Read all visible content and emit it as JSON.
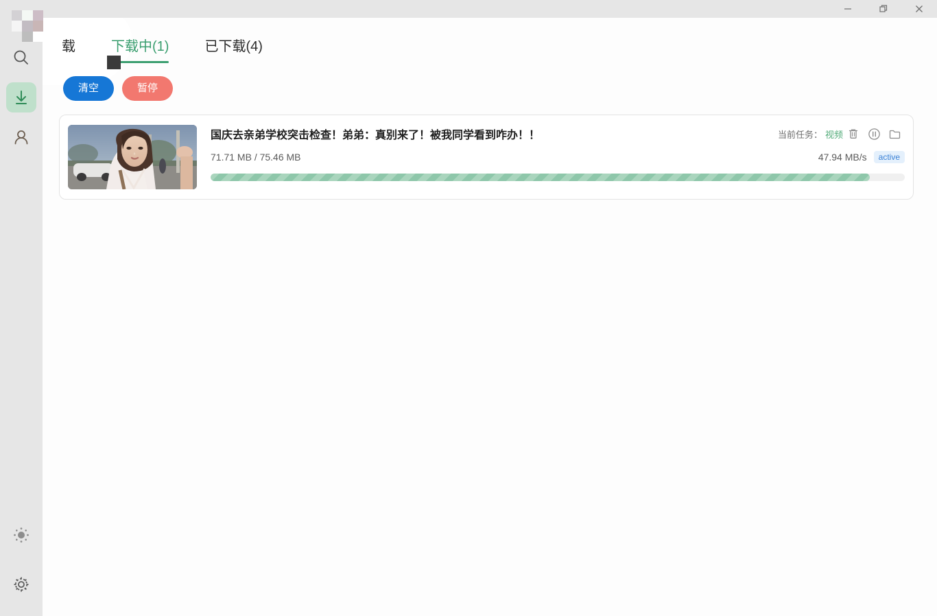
{
  "window": {
    "controls": [
      {
        "name": "minimize",
        "glyph": "minimize-icon"
      },
      {
        "name": "restore",
        "glyph": "restore-icon"
      },
      {
        "name": "close",
        "glyph": "close-icon"
      }
    ]
  },
  "sidebar": {
    "items": [
      {
        "icon": "search-icon",
        "active": false
      },
      {
        "icon": "download-icon",
        "active": true
      },
      {
        "icon": "user-icon",
        "active": false
      }
    ],
    "bottom_items": [
      {
        "icon": "brightness-icon",
        "active": false
      },
      {
        "icon": "settings-gear-icon",
        "active": false
      }
    ]
  },
  "tabs": [
    {
      "label": "载",
      "active": false,
      "occluded": true
    },
    {
      "label": "下载中(1)",
      "active": true,
      "occluded": false
    },
    {
      "label": "已下载(4)",
      "active": false,
      "occluded": false
    }
  ],
  "toolbar": {
    "clear_label": "清空",
    "pause_label": "暂停"
  },
  "downloads": [
    {
      "title": "国庆去亲弟学校突击检查！弟弟：真别来了！被我同学看到咋办！！",
      "downloaded": "71.71 MB",
      "total": "75.46 MB",
      "size_text": "71.71 MB / 75.46 MB",
      "speed": "47.94 MB/s",
      "status_badge": "active",
      "task_label": "当前任务：",
      "task_value": "视频",
      "progress_percent": 95,
      "actions": [
        {
          "icon": "trash-icon"
        },
        {
          "icon": "pause-circle-icon"
        },
        {
          "icon": "folder-icon"
        }
      ]
    }
  ],
  "colors": {
    "accent_green": "#3a9e6f",
    "progress_green": "#8ec7aa",
    "button_blue": "#1677d6",
    "button_red": "#f2786f",
    "badge_blue": "#3b82d6",
    "sidebar_bg": "#e6e6e6",
    "content_bg": "#fdfdfd"
  }
}
